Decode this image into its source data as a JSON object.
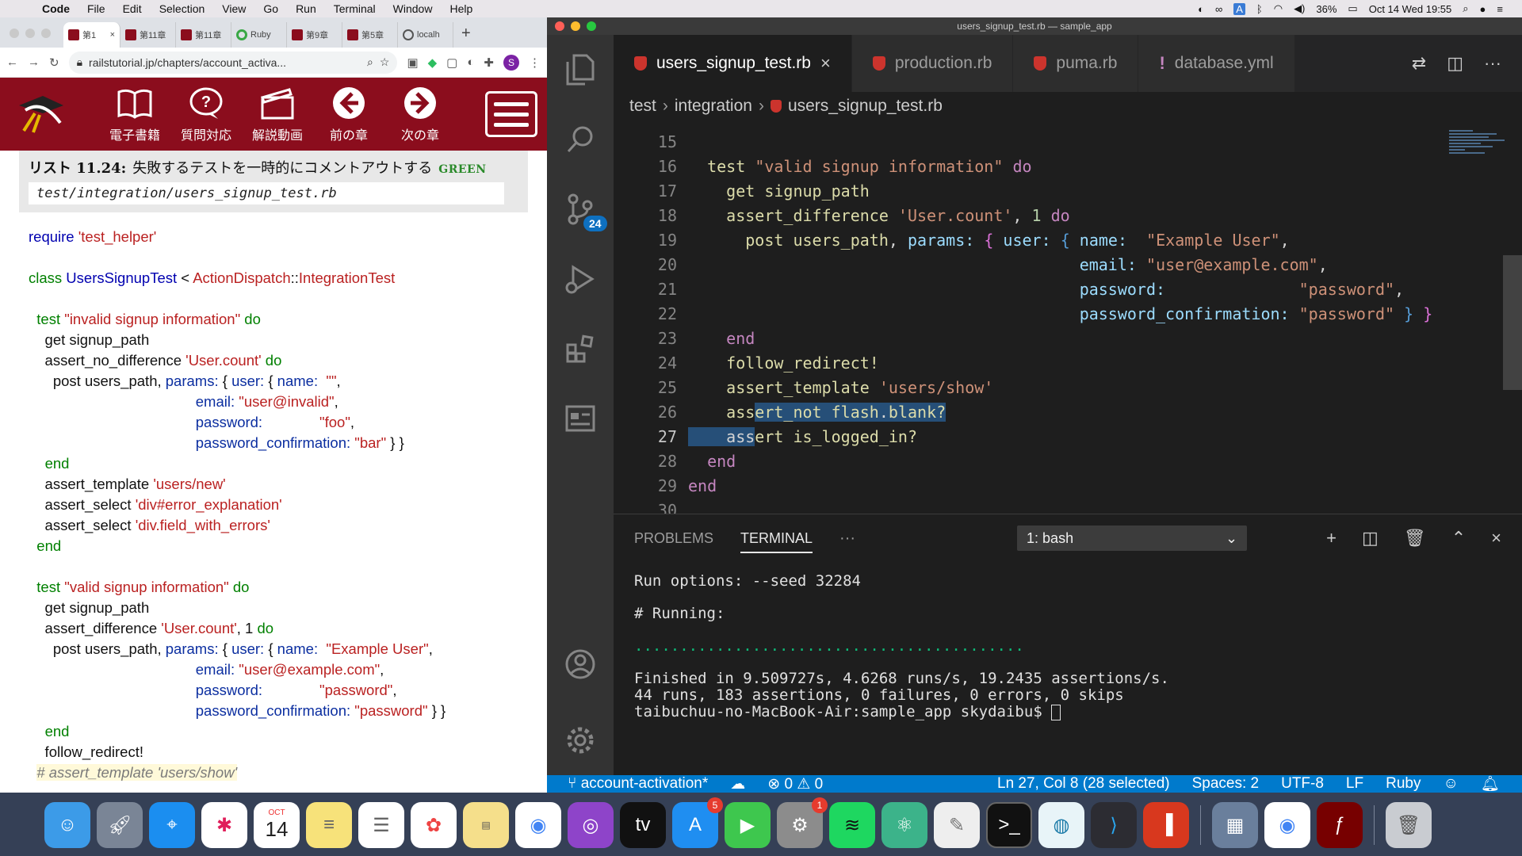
{
  "menubar": {
    "app": "Code",
    "items": [
      "File",
      "Edit",
      "Selection",
      "View",
      "Go",
      "Run",
      "Terminal",
      "Window",
      "Help"
    ],
    "battery": "36%",
    "datetime": "Oct 14 Wed  19:55",
    "input_indicator": "A"
  },
  "browser": {
    "tabs": [
      {
        "label": "第1",
        "icon": "railstutorial-favicon",
        "active": true
      },
      {
        "label": "第11章",
        "icon": "railstutorial-favicon"
      },
      {
        "label": "第11章",
        "icon": "railstutorial-favicon"
      },
      {
        "label": "Ruby",
        "icon": "ruby-favicon"
      },
      {
        "label": "第9章",
        "icon": "railstutorial-favicon"
      },
      {
        "label": "第5章",
        "icon": "railstutorial-favicon"
      },
      {
        "label": "localh",
        "icon": "globe-icon"
      }
    ],
    "url": "railstutorial.jp/chapters/account_activa...",
    "profile_initial": "S",
    "nav": [
      {
        "label": "電子書籍",
        "icon": "book-icon"
      },
      {
        "label": "質問対応",
        "icon": "question-bubble-icon"
      },
      {
        "label": "解説動画",
        "icon": "clapperboard-icon"
      },
      {
        "label": "前の章",
        "icon": "arrow-left-icon"
      },
      {
        "label": "次の章",
        "icon": "arrow-right-icon"
      }
    ],
    "listing": {
      "label": "リスト 11.24:",
      "title": "失敗するテストを一時的にコメントアウトする",
      "badge": "GREEN",
      "file": "test/integration/users_signup_test.rb"
    }
  },
  "vscode": {
    "window_title": "users_signup_test.rb — sample_app",
    "tabs": [
      {
        "label": "users_signup_test.rb",
        "active": true
      },
      {
        "label": "production.rb"
      },
      {
        "label": "puma.rb"
      },
      {
        "label": "database.yml"
      }
    ],
    "breadcrumb": [
      "test",
      "integration",
      "users_signup_test.rb"
    ],
    "scm_badge": "24",
    "line_numbers": [
      "15",
      "16",
      "17",
      "18",
      "19",
      "20",
      "21",
      "22",
      "23",
      "24",
      "25",
      "26",
      "27",
      "28",
      "29",
      "30"
    ],
    "panel": {
      "tabs": [
        "PROBLEMS",
        "TERMINAL"
      ],
      "more": "···",
      "terminal_select": "1: bash",
      "terminal_lines": [
        "Run options: --seed 32284",
        "",
        "# Running:",
        "",
        "...........................................",
        "",
        "Finished in 9.509727s, 4.6268 runs/s, 19.2435 assertions/s.",
        "44 runs, 183 assertions, 0 failures, 0 errors, 0 skips",
        "taibuchuu-no-MacBook-Air:sample_app skydaibu$ "
      ]
    },
    "status": {
      "branch": "account-activation*",
      "problems": "0",
      "warnings": "0",
      "cursor": "Ln 27, Col 8 (28 selected)",
      "spaces": "Spaces: 2",
      "encoding": "UTF-8",
      "eol": "LF",
      "language": "Ruby"
    }
  },
  "dock": {
    "calendar_month": "OCT",
    "calendar_day": "14",
    "appstore_badge": "5",
    "sysprefs_badge": "1"
  }
}
